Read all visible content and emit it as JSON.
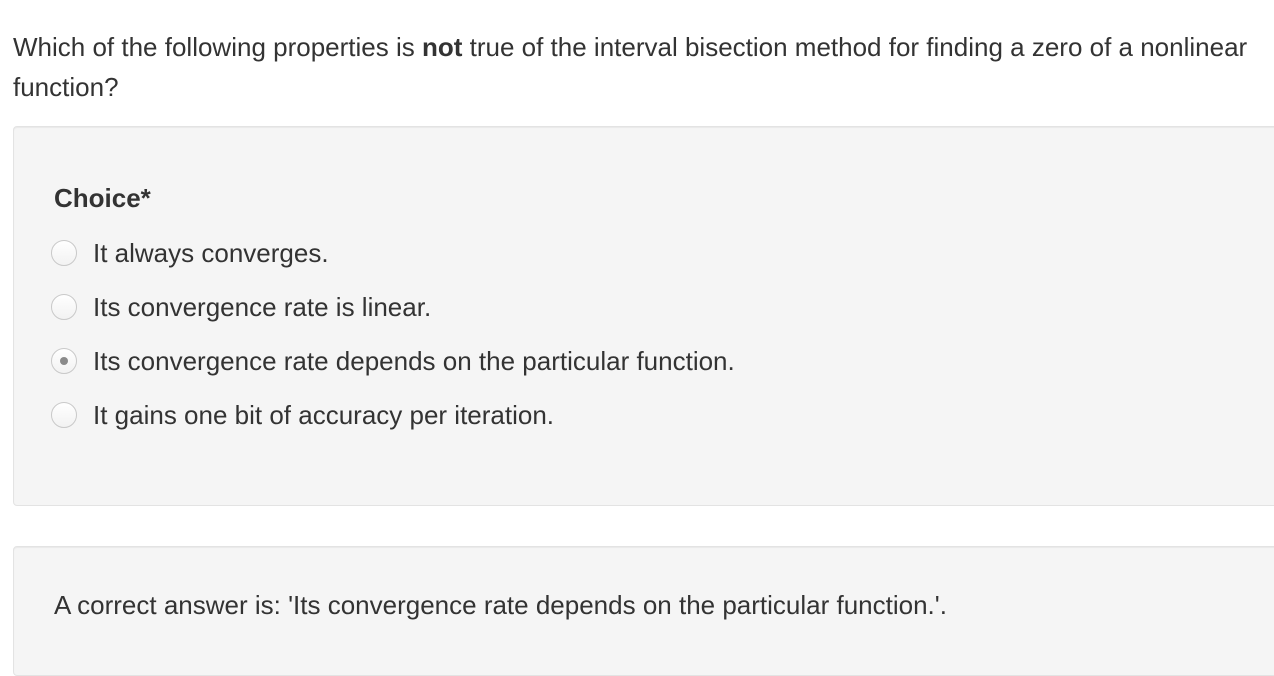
{
  "question": {
    "prefix": "Which of the following properties is ",
    "emphasis": "not",
    "suffix": " true of the interval bisection method for finding a zero of a nonlinear function?"
  },
  "form": {
    "field_label": "Choice*",
    "options": [
      {
        "label": "It always converges.",
        "selected": false
      },
      {
        "label": "Its convergence rate is linear.",
        "selected": false
      },
      {
        "label": "Its convergence rate depends on the particular function.",
        "selected": true
      },
      {
        "label": "It gains one bit of accuracy per iteration.",
        "selected": false
      }
    ]
  },
  "feedback": {
    "text": "A correct answer is: 'Its convergence rate depends on the particular function.'."
  },
  "colors": {
    "text": "#333333",
    "panel_bg": "#f5f5f5",
    "panel_border": "#e3e3e3",
    "radio_dot": "#8a8a8a"
  }
}
